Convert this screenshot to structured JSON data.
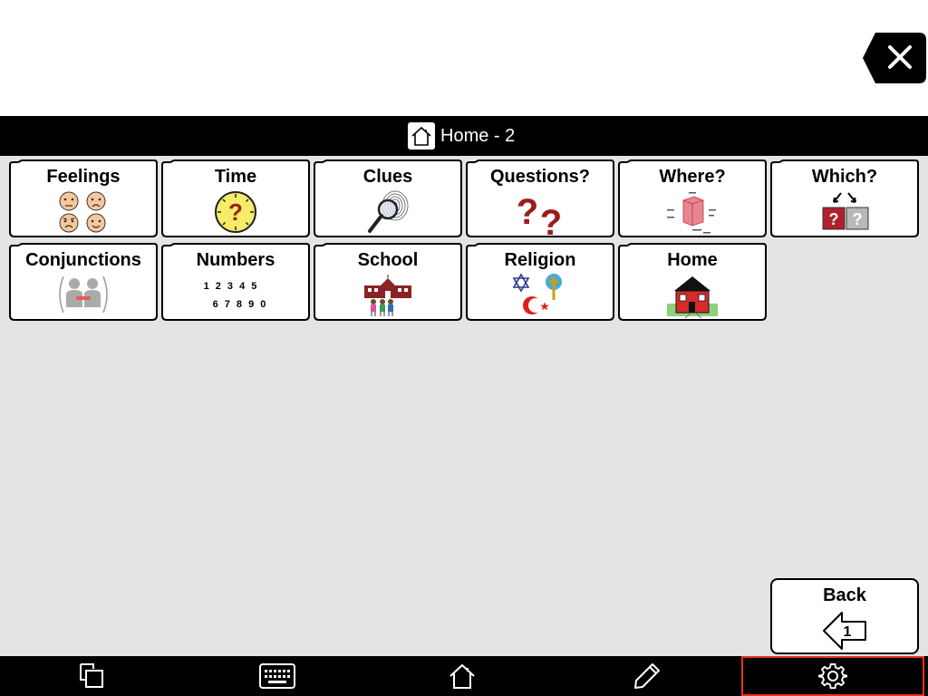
{
  "header": {
    "title": "Home - 2",
    "clear_icon": "backspace-x-icon"
  },
  "folders": [
    {
      "label": "Feelings",
      "icon": "faces-emotions-icon"
    },
    {
      "label": "Time",
      "icon": "clock-question-icon"
    },
    {
      "label": "Clues",
      "icon": "magnifier-fingerprint-icon"
    },
    {
      "label": "Questions?",
      "icon": "question-marks-icon"
    },
    {
      "label": "Where?",
      "icon": "position-cube-icon"
    },
    {
      "label": "Which?",
      "icon": "which-arrows-icon"
    },
    {
      "label": "Conjunctions",
      "icon": "linked-people-icon"
    },
    {
      "label": "Numbers",
      "icon": "numbers-icon",
      "digits_row1": "1 2 3 4 5",
      "digits_row2": "6 7 8 9 0"
    },
    {
      "label": "School",
      "icon": "school-children-icon"
    },
    {
      "label": "Religion",
      "icon": "religion-symbols-icon"
    },
    {
      "label": "Home",
      "icon": "red-house-icon"
    }
  ],
  "back": {
    "label": "Back",
    "page_number": "1",
    "icon": "back-arrow-icon"
  },
  "toolbar": {
    "items": [
      {
        "icon": "copy-pages-icon"
      },
      {
        "icon": "keyboard-icon"
      },
      {
        "icon": "home-icon"
      },
      {
        "icon": "pencil-icon"
      },
      {
        "icon": "gear-icon"
      }
    ]
  },
  "colors": {
    "background": "#e4e4e4",
    "bars": "#000000",
    "highlight": "#e8321e",
    "question_red": "#9b1c1c"
  }
}
